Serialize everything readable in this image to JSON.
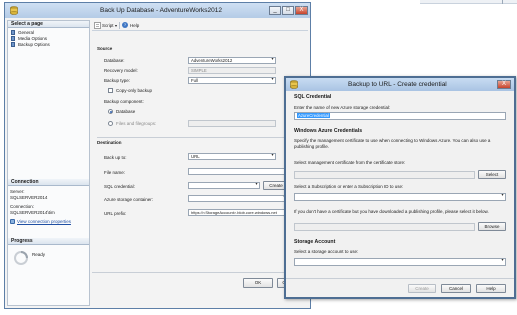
{
  "back_window": {
    "title": "Back Up Database - AdventureWorks2012",
    "controls": {
      "minimize": "_",
      "maximize": "□",
      "close": "X"
    },
    "toolbar": {
      "script_label": "Script",
      "help_label": "Help"
    },
    "select_page": {
      "header": "Select a page",
      "items": [
        {
          "label": "General"
        },
        {
          "label": "Media Options"
        },
        {
          "label": "Backup Options"
        }
      ]
    },
    "connection": {
      "header": "Connection",
      "server_label": "Server:",
      "server_value": "SQLSERVER2014",
      "connection_label": "Connection:",
      "connection_value": "SQLSERVER2014\\tim",
      "view_properties_link": "View connection properties"
    },
    "progress": {
      "header": "Progress",
      "status": "Ready"
    },
    "source": {
      "header": "Source",
      "database_label": "Database:",
      "database_value": "AdventureWorks2012",
      "recovery_label": "Recovery model:",
      "recovery_value": "SIMPLE",
      "backup_type_label": "Backup type:",
      "backup_type_value": "Full",
      "copy_only_label": "Copy-only backup",
      "component_label": "Backup component:",
      "database_option": "Database",
      "files_option": "Files and filegroups:"
    },
    "destination": {
      "header": "Destination",
      "backup_to_label": "Back up to:",
      "backup_to_value": "URL",
      "file_name_label": "File name:",
      "sql_credential_label": "SQL credential:",
      "create_label": "Create",
      "azure_container_label": "Azure storage container:",
      "url_prefix_label": "URL prefix:",
      "url_prefix_value": "https://<StorageAccount>.blob.core.windows.net"
    },
    "footer": {
      "ok_label": "OK",
      "cancel_label": "C"
    }
  },
  "front_window": {
    "title": "Backup to URL - Create credential",
    "controls": {
      "close": "X"
    },
    "sql_credential": {
      "header": "SQL Credential",
      "instruction": "Enter the name of new Azure storage credential:",
      "value": "AzureCredential"
    },
    "azure": {
      "header": "Windows Azure Credentials",
      "description_line1": "Specify the management certificate to use when connecting to Windows Azure. You can also use a",
      "description_line2": "publishing profile.",
      "cert_label": "Select management certificate from the certificate store:",
      "select_button": "Select",
      "subscription_label": "Select a Subscription or enter a Subscription ID to use:",
      "profile_label": "If you don't have a certificate but you have downloaded a publishing profile, please select it below.",
      "browse_button": "Browse"
    },
    "storage": {
      "header": "Storage Account",
      "label": "Select a storage account to use:"
    },
    "footer": {
      "create_label": "Create",
      "cancel_label": "Cancel",
      "help_label": "Help"
    }
  },
  "colors": {
    "title_bar": "#b4cbe6",
    "border": "#5d7fa7",
    "link": "#1f4fa3",
    "selection": "#3399ff"
  }
}
